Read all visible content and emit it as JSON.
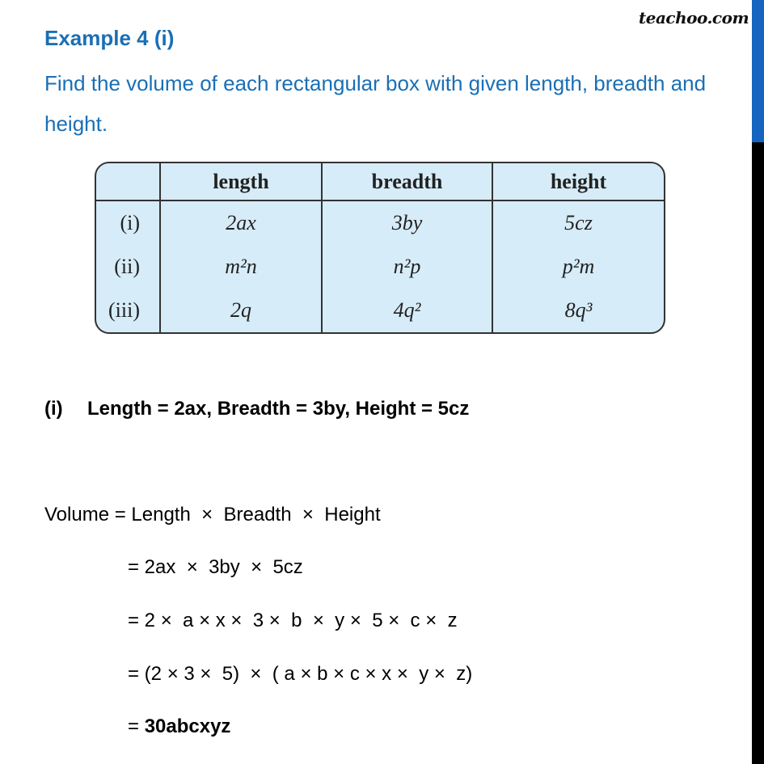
{
  "brand": "teachoo.com",
  "colors": {
    "heading": "#1a6fb5",
    "table_bg": "#d6ecf8",
    "scrollbar_thumb": "#1565c0",
    "scrollbar_track": "#000000"
  },
  "title": "Example 4 (i)",
  "question": "Find the volume of each rectangular box with given length, breadth and height.",
  "table": {
    "headers": [
      "",
      "length",
      "breadth",
      "height"
    ],
    "rows": [
      {
        "label": "(i)",
        "length": "2ax",
        "breadth": "3by",
        "height": "5cz"
      },
      {
        "label": "(ii)",
        "length": "m²n",
        "breadth": "n²p",
        "height": "p²m"
      },
      {
        "label": "(iii)",
        "length": "2q",
        "breadth": "4q²",
        "height": "8q³"
      }
    ]
  },
  "part": {
    "label": "(i)",
    "text": "Length = 2ax, Breadth = 3by, Height = 5cz"
  },
  "solution": {
    "steps": [
      "Volume = Length  ×  Breadth  ×  Height",
      "= 2ax  ×  3by  ×  5cz",
      "= 2 ×  a × x ×  3 ×  b  ×  y ×  5 ×  c ×  z",
      "= (2 × 3 ×  5)  ×  ( a × b × c × x ×  y ×  z)"
    ],
    "answer_prefix": "= ",
    "answer": "30abcxyz"
  }
}
